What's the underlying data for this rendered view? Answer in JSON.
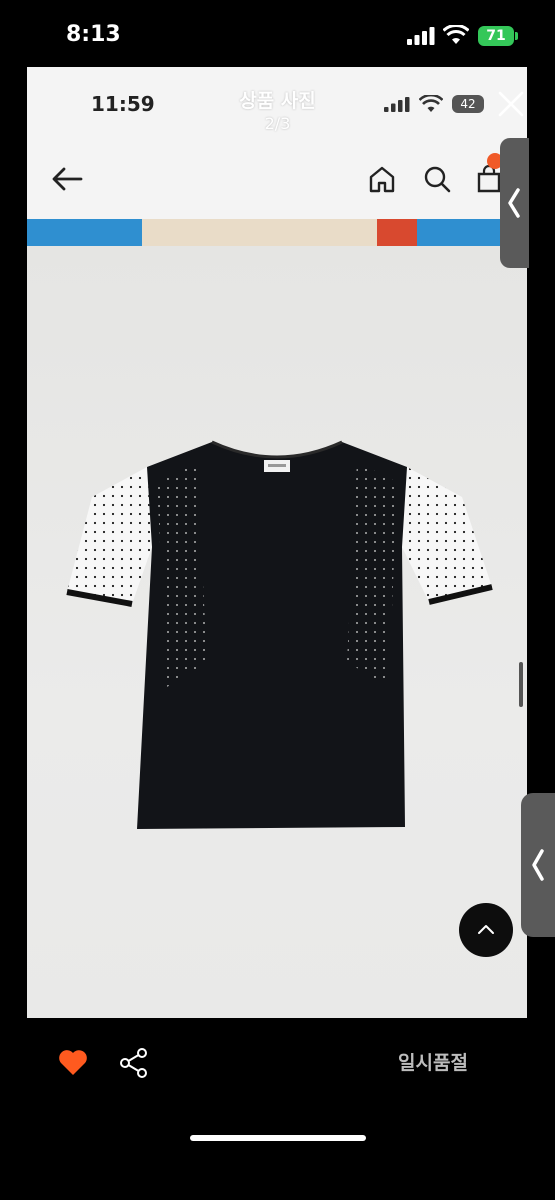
{
  "status_bar": {
    "time": "8:13",
    "battery": "71"
  },
  "viewer": {
    "inner_status": {
      "time": "11:59",
      "battery": "42"
    }
  },
  "overlay": {
    "title": "상품 사진",
    "counter": "2/3"
  },
  "bottom_bar": {
    "status_label": "일시품절"
  },
  "colors": {
    "accent": "#f05a28",
    "heart": "#ff5a1f",
    "battery_green": "#34c759"
  },
  "icons": [
    "back-arrow-icon",
    "home-icon",
    "search-icon",
    "cart-icon",
    "close-icon",
    "chevron-left-icon",
    "heart-icon",
    "share-icon",
    "chevron-up-icon"
  ]
}
